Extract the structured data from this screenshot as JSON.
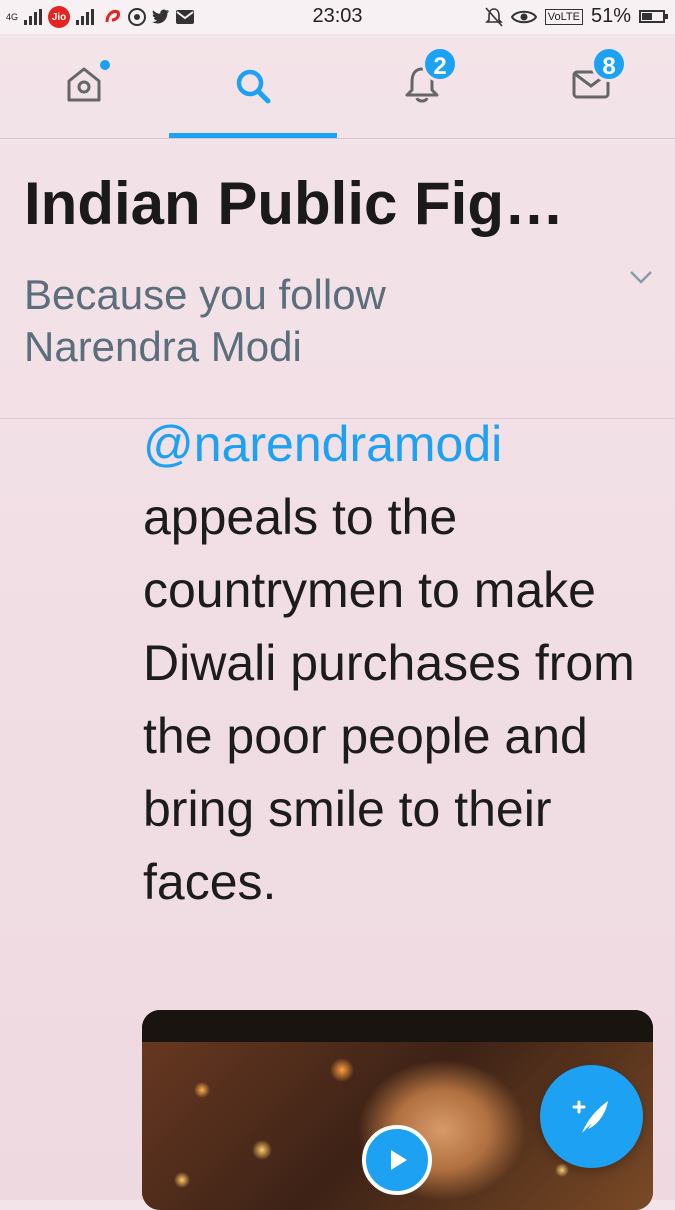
{
  "status_bar": {
    "network_type": "4G",
    "carrier": "Jio",
    "time": "23:03",
    "volte": "VoLTE",
    "battery": "51%",
    "battery_level": 0.51
  },
  "tabs": [
    {
      "name": "home",
      "icon": "home-icon",
      "badge": ""
    },
    {
      "name": "search",
      "icon": "search-icon",
      "badge": "",
      "active": true
    },
    {
      "name": "notifications",
      "icon": "bell-icon",
      "badge": "2"
    },
    {
      "name": "messages",
      "icon": "envelope-icon",
      "badge": "8"
    }
  ],
  "header": {
    "title": "Indian Public Fig…",
    "subtitle": "Because you follow Narendra Modi"
  },
  "tweet": {
    "mention": "@narendramodi",
    "body": "appeals to the countrymen to make Diwali purchases from the poor people and bring smile to their faces."
  },
  "colors": {
    "accent": "#1da1f2",
    "background": "#f1dfe5",
    "text": "#1c1c1c",
    "subtitle": "#5b6e7b"
  }
}
